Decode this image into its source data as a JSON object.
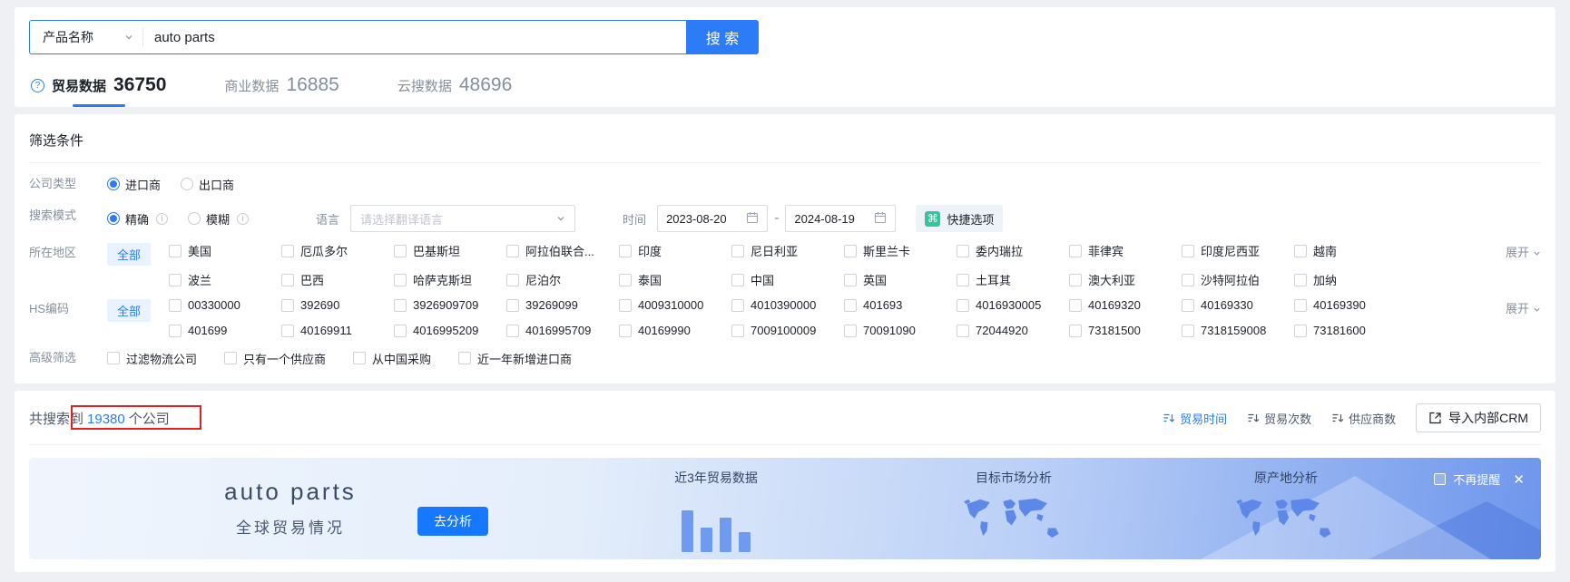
{
  "search": {
    "category": "产品名称",
    "query": "auto parts",
    "button": "搜 索",
    "help_glyph": "?"
  },
  "tabs": [
    {
      "label": "贸易数据",
      "count": "36750",
      "active": true
    },
    {
      "label": "商业数据",
      "count": "16885",
      "active": false
    },
    {
      "label": "云搜数据",
      "count": "48696",
      "active": false
    }
  ],
  "filters": {
    "title": "筛选条件",
    "company_type": {
      "label": "公司类型",
      "options": [
        {
          "text": "进口商"
        },
        {
          "text": "出口商"
        }
      ]
    },
    "search_mode": {
      "label": "搜索模式",
      "options": [
        {
          "text": "精确"
        },
        {
          "text": "模糊"
        }
      ],
      "info_glyph": "i"
    },
    "language": {
      "label": "语言",
      "placeholder": "请选择翻译语言"
    },
    "time": {
      "label": "时间",
      "start": "2023-08-20",
      "separator": "-",
      "end": "2024-08-19"
    },
    "quick_option": {
      "label": "快捷选项",
      "icon_glyph": "⌘"
    },
    "region": {
      "label": "所在地区",
      "all": "全部",
      "expand": "展开",
      "row1": [
        "美国",
        "厄瓜多尔",
        "巴基斯坦",
        "阿拉伯联合...",
        "印度",
        "尼日利亚",
        "斯里兰卡",
        "委内瑞拉",
        "菲律宾",
        "印度尼西亚",
        "越南"
      ],
      "row2": [
        "波兰",
        "巴西",
        "哈萨克斯坦",
        "尼泊尔",
        "泰国",
        "中国",
        "英国",
        "土耳其",
        "澳大利亚",
        "沙特阿拉伯",
        "加纳"
      ]
    },
    "hs_code": {
      "label": "HS编码",
      "all": "全部",
      "expand": "展开",
      "row1": [
        "00330000",
        "392690",
        "3926909709",
        "39269099",
        "4009310000",
        "4010390000",
        "401693",
        "4016930005",
        "40169320",
        "40169330",
        "40169390"
      ],
      "row2": [
        "401699",
        "40169911",
        "4016995209",
        "4016995709",
        "40169990",
        "7009100009",
        "70091090",
        "72044920",
        "73181500",
        "7318159008",
        "73181600"
      ]
    },
    "advanced": {
      "label": "高级筛选",
      "options": [
        "过滤物流公司",
        "只有一个供应商",
        "从中国采购",
        "近一年新增进口商"
      ]
    }
  },
  "results": {
    "summary_prefix": "共搜索到",
    "count": "19380",
    "summary_suffix": "个公司",
    "sorts": [
      {
        "label": "贸易时间",
        "active": true
      },
      {
        "label": "贸易次数",
        "active": false
      },
      {
        "label": "供应商数",
        "active": false
      }
    ],
    "crm_button": "导入内部CRM"
  },
  "banner": {
    "title": "auto parts",
    "subtitle": "全球贸易情况",
    "analyze_button": "去分析",
    "sections": [
      "近3年贸易数据",
      "目标市场分析",
      "原产地分析"
    ],
    "chart_bars": [
      46,
      27,
      38,
      22
    ],
    "dismiss_label": "不再提醒",
    "close_glyph": "✕"
  },
  "colors": {
    "accent_blue": "#2b7cf6",
    "quick_icon_teal": "#35c3a0",
    "annotation_red": "#e02222",
    "banner_deep_blue": "#6e96ec"
  }
}
